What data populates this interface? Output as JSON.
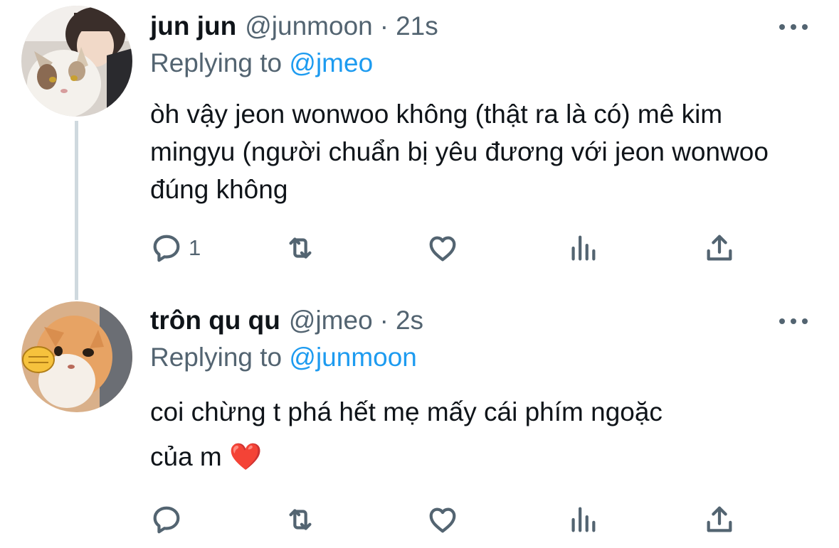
{
  "tweets": [
    {
      "name": "jun jun",
      "handle": "@junmoon",
      "separator": "·",
      "time": "21s",
      "reply_prefix": "Replying to",
      "reply_to": "@jmeo",
      "text": "òh vậy jeon wonwoo không (thật ra là có) mê kim mingyu (người chuẩn bị yêu đương với jeon wonwoo đúng không",
      "reply_count": "1",
      "icons": [
        "reply-icon",
        "retweet-icon",
        "like-icon",
        "analytics-icon",
        "share-icon"
      ]
    },
    {
      "name": "trôn qu qu",
      "handle": "@jmeo",
      "separator": "·",
      "time": "2s",
      "reply_prefix": "Replying to",
      "reply_to": "@junmoon",
      "text_line1": "coi chừng t phá hết mẹ mấy cái phím ngoặc",
      "text_line2": "của m",
      "emoji": "❤️",
      "reply_count": "",
      "icons": [
        "reply-icon",
        "retweet-icon",
        "like-icon",
        "analytics-icon",
        "share-icon"
      ]
    }
  ],
  "colors": {
    "text": "#0f1419",
    "secondary": "#536471",
    "link": "#1d9bf0",
    "thread_line": "#cfd9de",
    "heart": "#e0245e"
  }
}
